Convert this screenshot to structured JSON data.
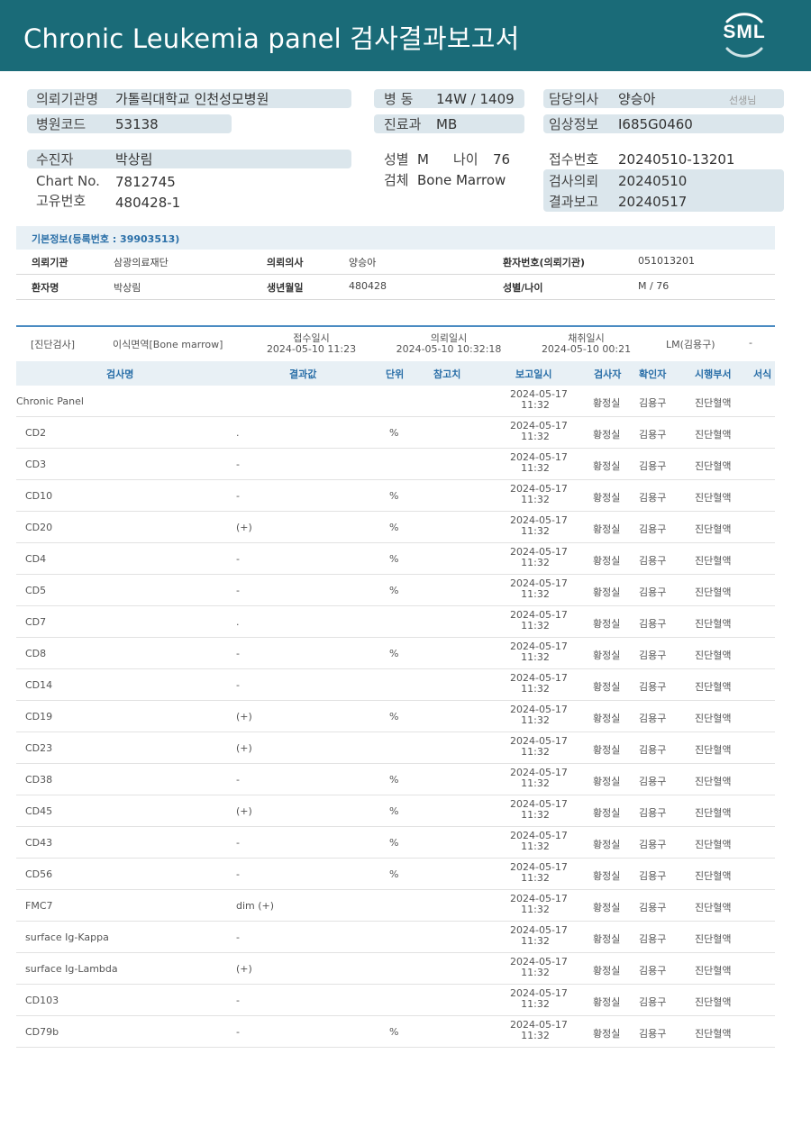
{
  "report": {
    "title": "Chronic  Leukemia  panel 검사결과보고서",
    "logo": "SML"
  },
  "patient_header": {
    "hospital_label": "의뢰기관명",
    "hospital": "가톨릭대학교 인천성모병원",
    "hospital_code_label": "병원코드",
    "hospital_code": "53138",
    "ward_label": "병  동",
    "ward": "14W / 1409",
    "dept_label": "진료과",
    "dept": "MB",
    "doctor_label": "담당의사",
    "doctor": "양승아",
    "doctor_suffix": "선생님",
    "clinical_label": "임상정보",
    "clinical": "I685G0460",
    "patient_label": "수진자",
    "patient": "박상림",
    "chart_label": "Chart No.",
    "chart": "7812745",
    "unique_label": "고유번호",
    "unique": "480428-1",
    "sex_label": "성별",
    "sex": "M",
    "age_label": "나이",
    "age": "76",
    "specimen_label": "검체",
    "specimen": "Bone Marrow",
    "receipt_label": "접수번호",
    "receipt": "20240510-13201",
    "request_label": "검사의뢰",
    "request": "20240510",
    "result_label": "결과보고",
    "result": "20240517"
  },
  "basic_info": {
    "title": "기본정보(등록번호 : 39903513)",
    "row1": [
      "의뢰기관",
      "삼광의료재단",
      "의뢰의사",
      "양승아",
      "환자번호(의뢰기관)",
      "051013201"
    ],
    "row2": [
      "환자명",
      "박상림",
      "생년월일",
      "480428",
      "성별/나이",
      "M / 76"
    ]
  },
  "category": {
    "name": "[진단검사]",
    "specimen": "이식면역[Bone marrow]",
    "receipt_label": "접수일시",
    "receipt": "2024-05-10 11:23",
    "request_label": "의뢰일시",
    "request": "2024-05-10 10:32:18",
    "collect_label": "채취일시",
    "collect": "2024-05-10 00:21",
    "lm": "LM(김용구)",
    "dash": "-"
  },
  "table": {
    "headers": [
      "검사명",
      "결과값",
      "단위",
      "참고치",
      "보고일시",
      "검사자",
      "확인자",
      "시행부서",
      "서식"
    ],
    "rows": [
      {
        "name": "Chronic Panel",
        "result": "",
        "unit": "",
        "date": "2024-05-17",
        "time": "11:32",
        "tester": "황정실",
        "checker": "김용구",
        "dept": "진단혈액"
      },
      {
        "name": "CD2",
        "result": ".",
        "unit": "%",
        "date": "2024-05-17",
        "time": "11:32",
        "tester": "황정실",
        "checker": "김용구",
        "dept": "진단혈액"
      },
      {
        "name": "CD3",
        "result": "-",
        "unit": "",
        "date": "2024-05-17",
        "time": "11:32",
        "tester": "황정실",
        "checker": "김용구",
        "dept": "진단혈액"
      },
      {
        "name": "CD10",
        "result": "-",
        "unit": "%",
        "date": "2024-05-17",
        "time": "11:32",
        "tester": "황정실",
        "checker": "김용구",
        "dept": "진단혈액"
      },
      {
        "name": "CD20",
        "result": "(+)",
        "unit": "%",
        "date": "2024-05-17",
        "time": "11:32",
        "tester": "황정실",
        "checker": "김용구",
        "dept": "진단혈액"
      },
      {
        "name": "CD4",
        "result": "-",
        "unit": "%",
        "date": "2024-05-17",
        "time": "11:32",
        "tester": "황정실",
        "checker": "김용구",
        "dept": "진단혈액"
      },
      {
        "name": "CD5",
        "result": "-",
        "unit": "%",
        "date": "2024-05-17",
        "time": "11:32",
        "tester": "황정실",
        "checker": "김용구",
        "dept": "진단혈액"
      },
      {
        "name": "CD7",
        "result": ".",
        "unit": "",
        "date": "2024-05-17",
        "time": "11:32",
        "tester": "황정실",
        "checker": "김용구",
        "dept": "진단혈액"
      },
      {
        "name": "CD8",
        "result": "-",
        "unit": "%",
        "date": "2024-05-17",
        "time": "11:32",
        "tester": "황정실",
        "checker": "김용구",
        "dept": "진단혈액"
      },
      {
        "name": "CD14",
        "result": "-",
        "unit": "",
        "date": "2024-05-17",
        "time": "11:32",
        "tester": "황정실",
        "checker": "김용구",
        "dept": "진단혈액"
      },
      {
        "name": "CD19",
        "result": "(+)",
        "unit": "%",
        "date": "2024-05-17",
        "time": "11:32",
        "tester": "황정실",
        "checker": "김용구",
        "dept": "진단혈액"
      },
      {
        "name": "CD23",
        "result": "(+)",
        "unit": "",
        "date": "2024-05-17",
        "time": "11:32",
        "tester": "황정실",
        "checker": "김용구",
        "dept": "진단혈액"
      },
      {
        "name": "CD38",
        "result": "-",
        "unit": "%",
        "date": "2024-05-17",
        "time": "11:32",
        "tester": "황정실",
        "checker": "김용구",
        "dept": "진단혈액"
      },
      {
        "name": "CD45",
        "result": "(+)",
        "unit": "%",
        "date": "2024-05-17",
        "time": "11:32",
        "tester": "황정실",
        "checker": "김용구",
        "dept": "진단혈액"
      },
      {
        "name": "CD43",
        "result": "-",
        "unit": "%",
        "date": "2024-05-17",
        "time": "11:32",
        "tester": "황정실",
        "checker": "김용구",
        "dept": "진단혈액"
      },
      {
        "name": "CD56",
        "result": "-",
        "unit": "%",
        "date": "2024-05-17",
        "time": "11:32",
        "tester": "황정실",
        "checker": "김용구",
        "dept": "진단혈액"
      },
      {
        "name": "FMC7",
        "result": "dim (+)",
        "unit": "",
        "date": "2024-05-17",
        "time": "11:32",
        "tester": "황정실",
        "checker": "김용구",
        "dept": "진단혈액"
      },
      {
        "name": "surface Ig-Kappa",
        "result": "-",
        "unit": "",
        "date": "2024-05-17",
        "time": "11:32",
        "tester": "황정실",
        "checker": "김용구",
        "dept": "진단혈액"
      },
      {
        "name": "surface Ig-Lambda",
        "result": "(+)",
        "unit": "",
        "date": "2024-05-17",
        "time": "11:32",
        "tester": "황정실",
        "checker": "김용구",
        "dept": "진단혈액"
      },
      {
        "name": "CD103",
        "result": "-",
        "unit": "",
        "date": "2024-05-17",
        "time": "11:32",
        "tester": "황정실",
        "checker": "김용구",
        "dept": "진단혈액"
      },
      {
        "name": "CD79b",
        "result": "-",
        "unit": "%",
        "date": "2024-05-17",
        "time": "11:32",
        "tester": "황정실",
        "checker": "김용구",
        "dept": "진단혈액"
      }
    ]
  },
  "colors": {
    "header_bg": "#1a6b78",
    "pill_bg": "#dbe6ec",
    "accent_blue": "#2a6fa8"
  }
}
